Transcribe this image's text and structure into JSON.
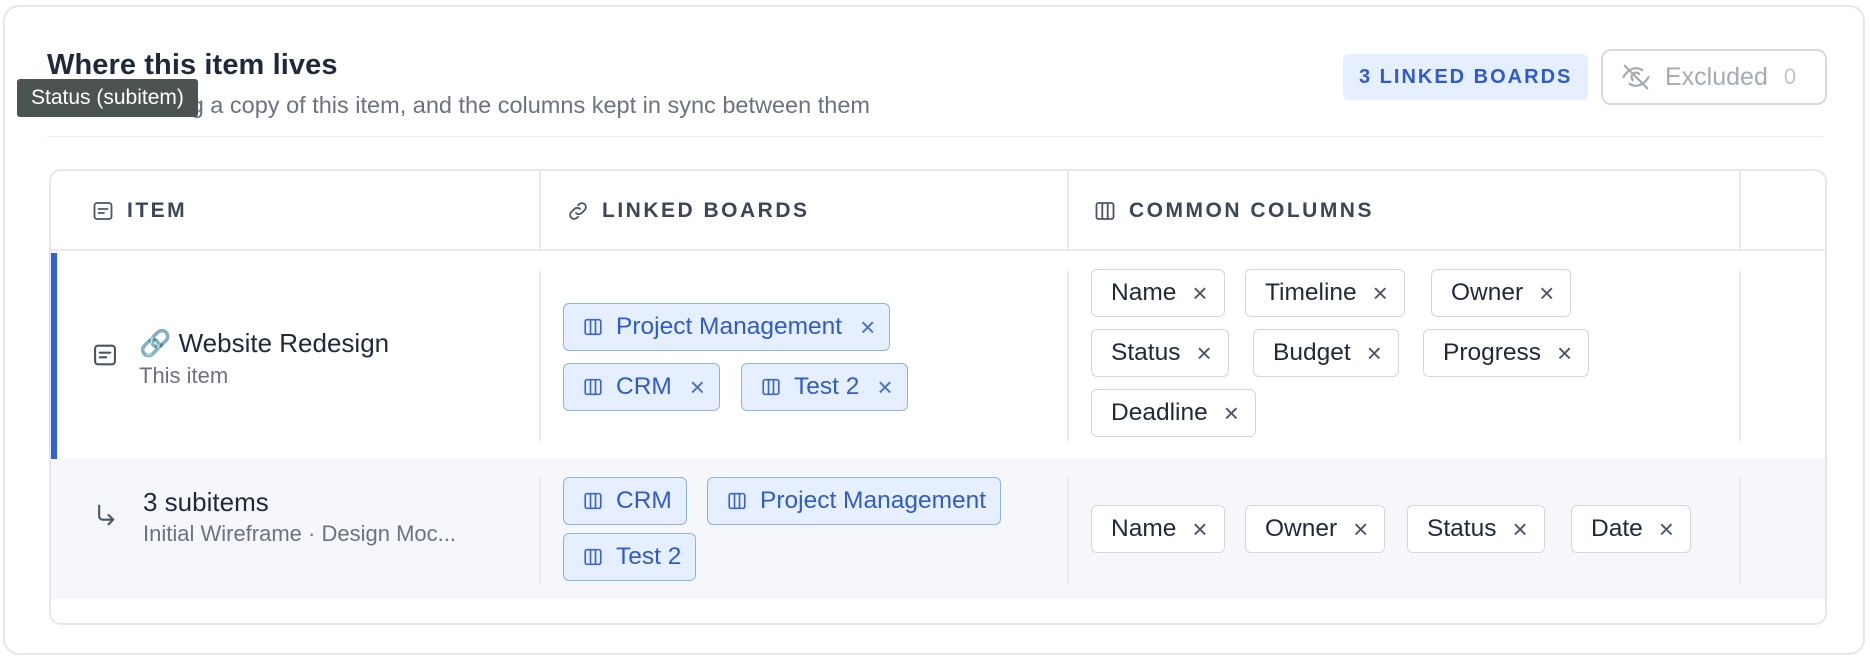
{
  "tooltip": "Status (subitem)",
  "header": {
    "title": "Where this item lives",
    "subtitle": "Boards holding a copy of this item, and the columns kept in sync between them",
    "linked_badge": "3 LINKED BOARDS",
    "excluded_label": "Excluded",
    "excluded_count": "0"
  },
  "table": {
    "columns": [
      "ITEM",
      "LINKED BOARDS",
      "COMMON COLUMNS"
    ],
    "rows": [
      {
        "name": "🔗 Website Redesign",
        "sub": "This item",
        "boards": [
          "Project Management",
          "CRM",
          "Test 2"
        ],
        "common_columns": [
          "Name",
          "Timeline",
          "Owner",
          "Status",
          "Budget",
          "Progress",
          "Deadline"
        ]
      },
      {
        "name": "3 subitems",
        "sub": "Initial Wireframe · Design Moc...",
        "boards": [
          "CRM",
          "Project Management",
          "Test 2"
        ],
        "common_columns": [
          "Name",
          "Owner",
          "Status",
          "Date"
        ]
      }
    ]
  },
  "icons": {
    "item": "item-card-icon",
    "link": "link-icon",
    "columns": "columns-icon",
    "subitem": "subitem-arrow-icon",
    "eye_off": "eye-off-icon",
    "remove": "close-icon"
  },
  "colors": {
    "accent": "#2f62d6",
    "chip_bg": "#e6efff",
    "chip_text": "#2f5cc9",
    "tooltip_bg": "#4b5353"
  }
}
